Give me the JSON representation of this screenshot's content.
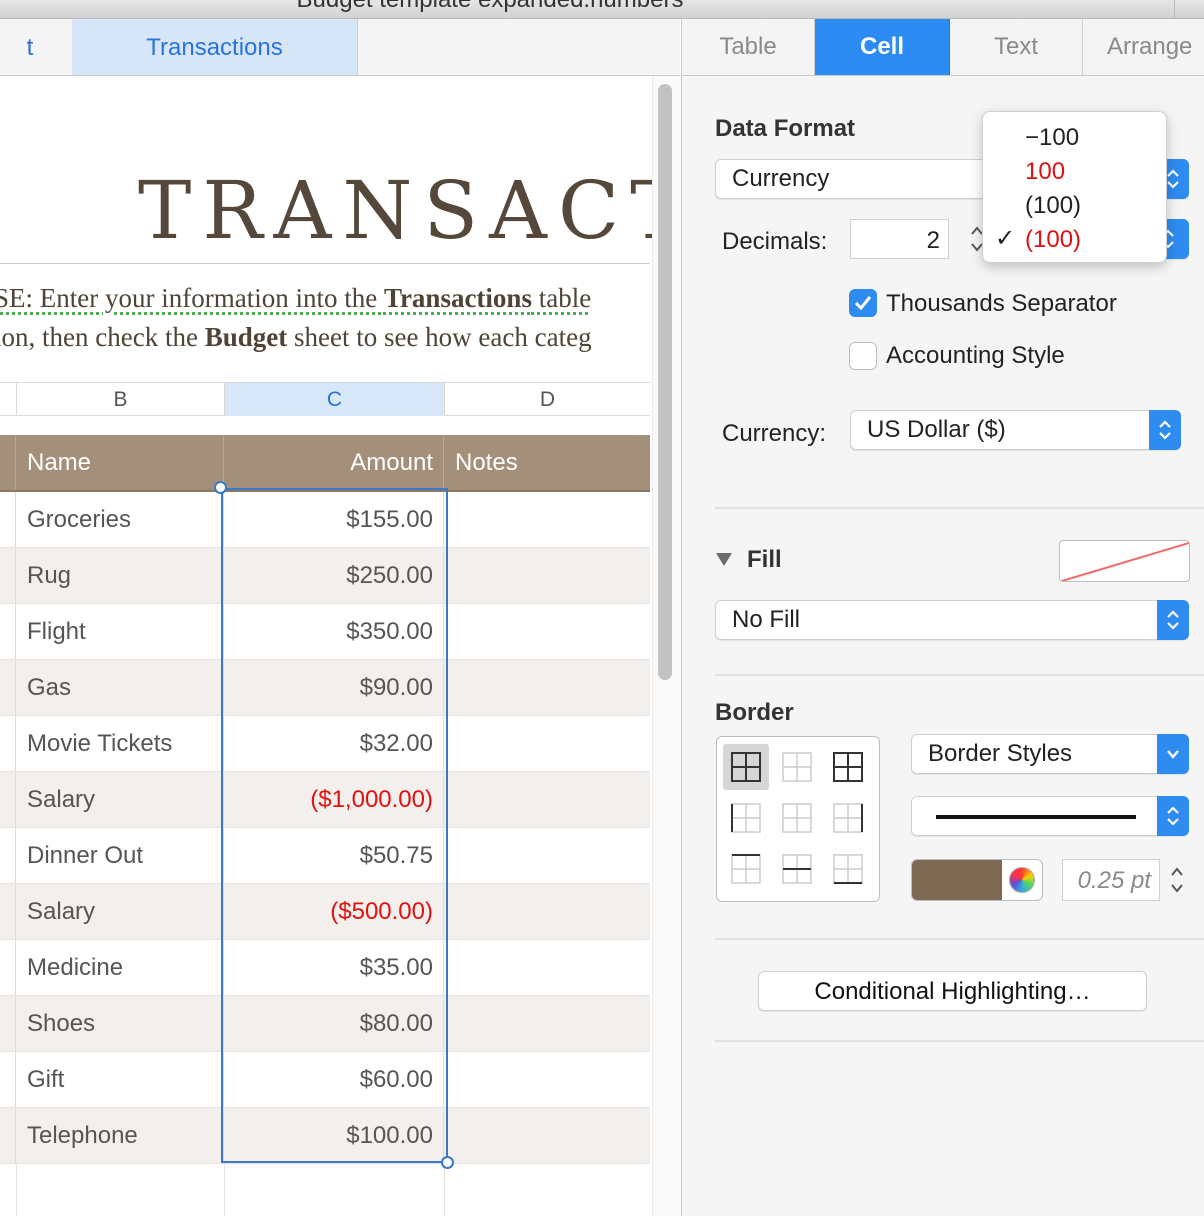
{
  "window": {
    "title": "Budget template expanded.numbers"
  },
  "sheet_tabs": [
    {
      "label": "t"
    },
    {
      "label": "Transactions",
      "selected": true
    }
  ],
  "sheet": {
    "title": "TRANSACTIO",
    "instructions": {
      "line1_pre": "SE: Enter your information into the ",
      "line1_bold": "Transactions",
      "line1_post": " table",
      "line2_pre": "ion, then check the ",
      "line2_bold": "Budget",
      "line2_post": " sheet to see how each categ"
    },
    "column_headers": [
      "B",
      "C",
      "D"
    ],
    "selected_column": "C",
    "table": {
      "headers": {
        "name": "Name",
        "amount": "Amount",
        "notes": "Notes"
      },
      "rows": [
        {
          "name": "Groceries",
          "amount": "$155.00",
          "negative": false
        },
        {
          "name": "Rug",
          "amount": "$250.00",
          "negative": false
        },
        {
          "name": "Flight",
          "amount": "$350.00",
          "negative": false
        },
        {
          "name": "Gas",
          "amount": "$90.00",
          "negative": false
        },
        {
          "name": "Movie Tickets",
          "amount": "$32.00",
          "negative": false
        },
        {
          "name": "Salary",
          "amount": "($1,000.00)",
          "negative": true
        },
        {
          "name": "Dinner Out",
          "amount": "$50.75",
          "negative": false
        },
        {
          "name": "Salary",
          "amount": "($500.00)",
          "negative": true
        },
        {
          "name": "Medicine",
          "amount": "$35.00",
          "negative": false
        },
        {
          "name": "Shoes",
          "amount": "$80.00",
          "negative": false
        },
        {
          "name": "Gift",
          "amount": "$60.00",
          "negative": false
        },
        {
          "name": "Telephone",
          "amount": "$100.00",
          "negative": false
        }
      ]
    }
  },
  "inspector": {
    "tabs": [
      {
        "label": "Table"
      },
      {
        "label": "Cell",
        "selected": true
      },
      {
        "label": "Text"
      },
      {
        "label": "Arrange"
      }
    ],
    "data_format": {
      "heading": "Data Format",
      "format_value": "Currency",
      "decimals_label": "Decimals:",
      "decimals_value": "2",
      "negative_menu": {
        "options": [
          "−100",
          "100",
          "(100)",
          "(100)"
        ],
        "checked_index": 3,
        "red_options": [
          1,
          3
        ],
        "checkmark": "✓"
      },
      "thousands_separator": {
        "label": "Thousands Separator",
        "checked": true
      },
      "accounting_style": {
        "label": "Accounting Style",
        "checked": false
      },
      "currency_label": "Currency:",
      "currency_value": "US Dollar ($)"
    },
    "fill": {
      "heading": "Fill",
      "value": "No Fill"
    },
    "border": {
      "heading": "Border",
      "styles_value": "Border Styles",
      "color": "#7e6a52",
      "width_value": "0.25 pt"
    },
    "conditional_button": "Conditional Highlighting…"
  },
  "colors": {
    "accent": "#2e8cf0",
    "table_header": "#a48f7b",
    "negative": "#e0110f",
    "title_brown": "#55483a"
  }
}
